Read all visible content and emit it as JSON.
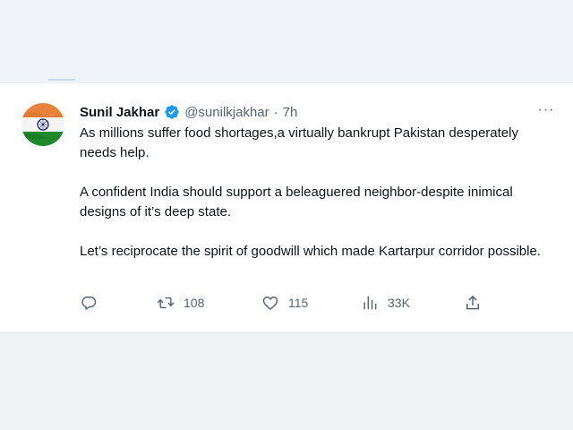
{
  "tweet": {
    "author_name": "Sunil Jakhar",
    "handle": "@sunilkjakhar",
    "separator": "·",
    "time": "7h",
    "more_label": "···",
    "paragraphs": [
      "As millions suffer food shortages,a virtually bankrupt Pakistan desperately needs help.",
      "A confident India should support a beleaguered neighbor-despite inimical designs of it’s deep state.",
      "Let’s reciprocate the spirit of goodwill which made Kartarpur corridor possible."
    ],
    "actions": {
      "reply_count": "",
      "retweet_count": "108",
      "like_count": "115",
      "views_count": "33K"
    }
  },
  "icons": {
    "verified": "verified-badge-icon",
    "reply": "reply-icon",
    "retweet": "retweet-icon",
    "like": "heart-icon",
    "views": "views-bar-chart-icon",
    "share": "share-icon",
    "more": "more-horizontal-icon"
  },
  "colors": {
    "verified_blue": "#1d9bf0",
    "icon_gray": "#536471",
    "text": "#0f1419",
    "flag_saffron": "#ff9933",
    "flag_green": "#138808",
    "chakra_navy": "#000080"
  }
}
